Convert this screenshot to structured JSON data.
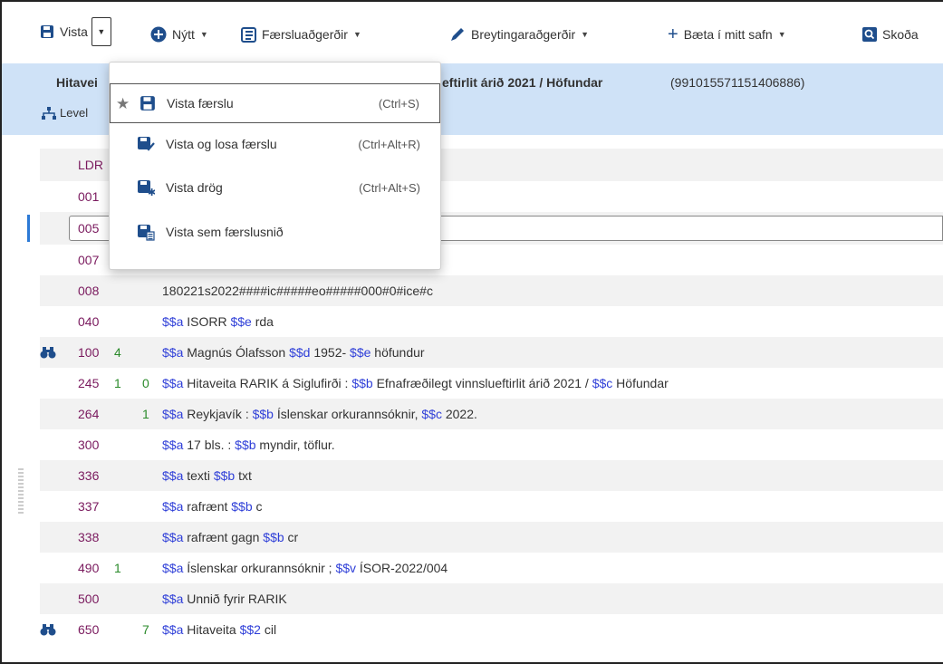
{
  "toolbar": {
    "save_label": "Vista",
    "new_label": "Nýtt",
    "record_actions_label": "Færsluaðgerðir",
    "edit_actions_label": "Breytingaraðgerðir",
    "add_collection_label": "Bæta í mitt safn",
    "view_label": "Skoða"
  },
  "header": {
    "title_start": "Hitavei",
    "title_end": "eftirlit árið 2021 / Höfundar",
    "record_id": "(991015571151406886)",
    "level_label": "Level"
  },
  "dropdown": {
    "items": [
      {
        "label": "Vista færslu",
        "shortcut": "(Ctrl+S)"
      },
      {
        "label": "Vista og losa færslu",
        "shortcut": "(Ctrl+Alt+R)"
      },
      {
        "label": "Vista drög",
        "shortcut": "(Ctrl+Alt+S)"
      },
      {
        "label": "Vista sem færslusnið",
        "shortcut": ""
      }
    ]
  },
  "fields": [
    {
      "tag": "LDR",
      "ind1": "",
      "ind2": "",
      "content": ""
    },
    {
      "tag": "001",
      "ind1": "",
      "ind2": "",
      "content": ""
    },
    {
      "tag": "005",
      "ind1": "",
      "ind2": "",
      "content": ""
    },
    {
      "tag": "007",
      "ind1": "",
      "ind2": "",
      "content": ""
    },
    {
      "tag": "008",
      "ind1": "",
      "ind2": "",
      "content": "180221s2022####ic#####eo#####000#0#ice#c"
    },
    {
      "tag": "040",
      "ind1": "",
      "ind2": "",
      "sub": [
        [
          "$$a",
          " ISORR "
        ],
        [
          "$$e",
          " rda"
        ]
      ]
    },
    {
      "tag": "100",
      "ind1": "4",
      "ind2": "",
      "sub": [
        [
          "$$a",
          " Magnús Ólafsson "
        ],
        [
          "$$d",
          " 1952- "
        ],
        [
          "$$e",
          " höfundur"
        ]
      ]
    },
    {
      "tag": "245",
      "ind1": "1",
      "ind2": "0",
      "sub": [
        [
          "$$a",
          " Hitaveita RARIK á Siglufirði : "
        ],
        [
          "$$b",
          " Efnafræðilegt vinnslueftirlit árið 2021 / "
        ],
        [
          "$$c",
          " Höfundar"
        ]
      ]
    },
    {
      "tag": "264",
      "ind1": "",
      "ind2": "1",
      "sub": [
        [
          "$$a",
          " Reykjavík : "
        ],
        [
          "$$b",
          " Íslenskar orkurannsóknir, "
        ],
        [
          "$$c",
          " 2022."
        ]
      ]
    },
    {
      "tag": "300",
      "ind1": "",
      "ind2": "",
      "sub": [
        [
          "$$a",
          " 17 bls. : "
        ],
        [
          "$$b",
          " myndir, töflur."
        ]
      ]
    },
    {
      "tag": "336",
      "ind1": "",
      "ind2": "",
      "sub": [
        [
          "$$a",
          " texti "
        ],
        [
          "$$b",
          " txt"
        ]
      ]
    },
    {
      "tag": "337",
      "ind1": "",
      "ind2": "",
      "sub": [
        [
          "$$a",
          " rafrænt "
        ],
        [
          "$$b",
          " c"
        ]
      ]
    },
    {
      "tag": "338",
      "ind1": "",
      "ind2": "",
      "sub": [
        [
          "$$a",
          " rafrænt gagn "
        ],
        [
          "$$b",
          " cr"
        ]
      ]
    },
    {
      "tag": "490",
      "ind1": "1",
      "ind2": "",
      "sub": [
        [
          "$$a",
          " Íslenskar orkurannsóknir ; "
        ],
        [
          "$$v",
          " ÍSOR-2022/004"
        ]
      ]
    },
    {
      "tag": "500",
      "ind1": "",
      "ind2": "",
      "sub": [
        [
          "$$a",
          " Unnið fyrir RARIK"
        ]
      ]
    },
    {
      "tag": "650",
      "ind1": "",
      "ind2": "7",
      "sub": [
        [
          "$$a",
          " Hitaveita "
        ],
        [
          "$$2",
          " cil"
        ]
      ]
    }
  ]
}
